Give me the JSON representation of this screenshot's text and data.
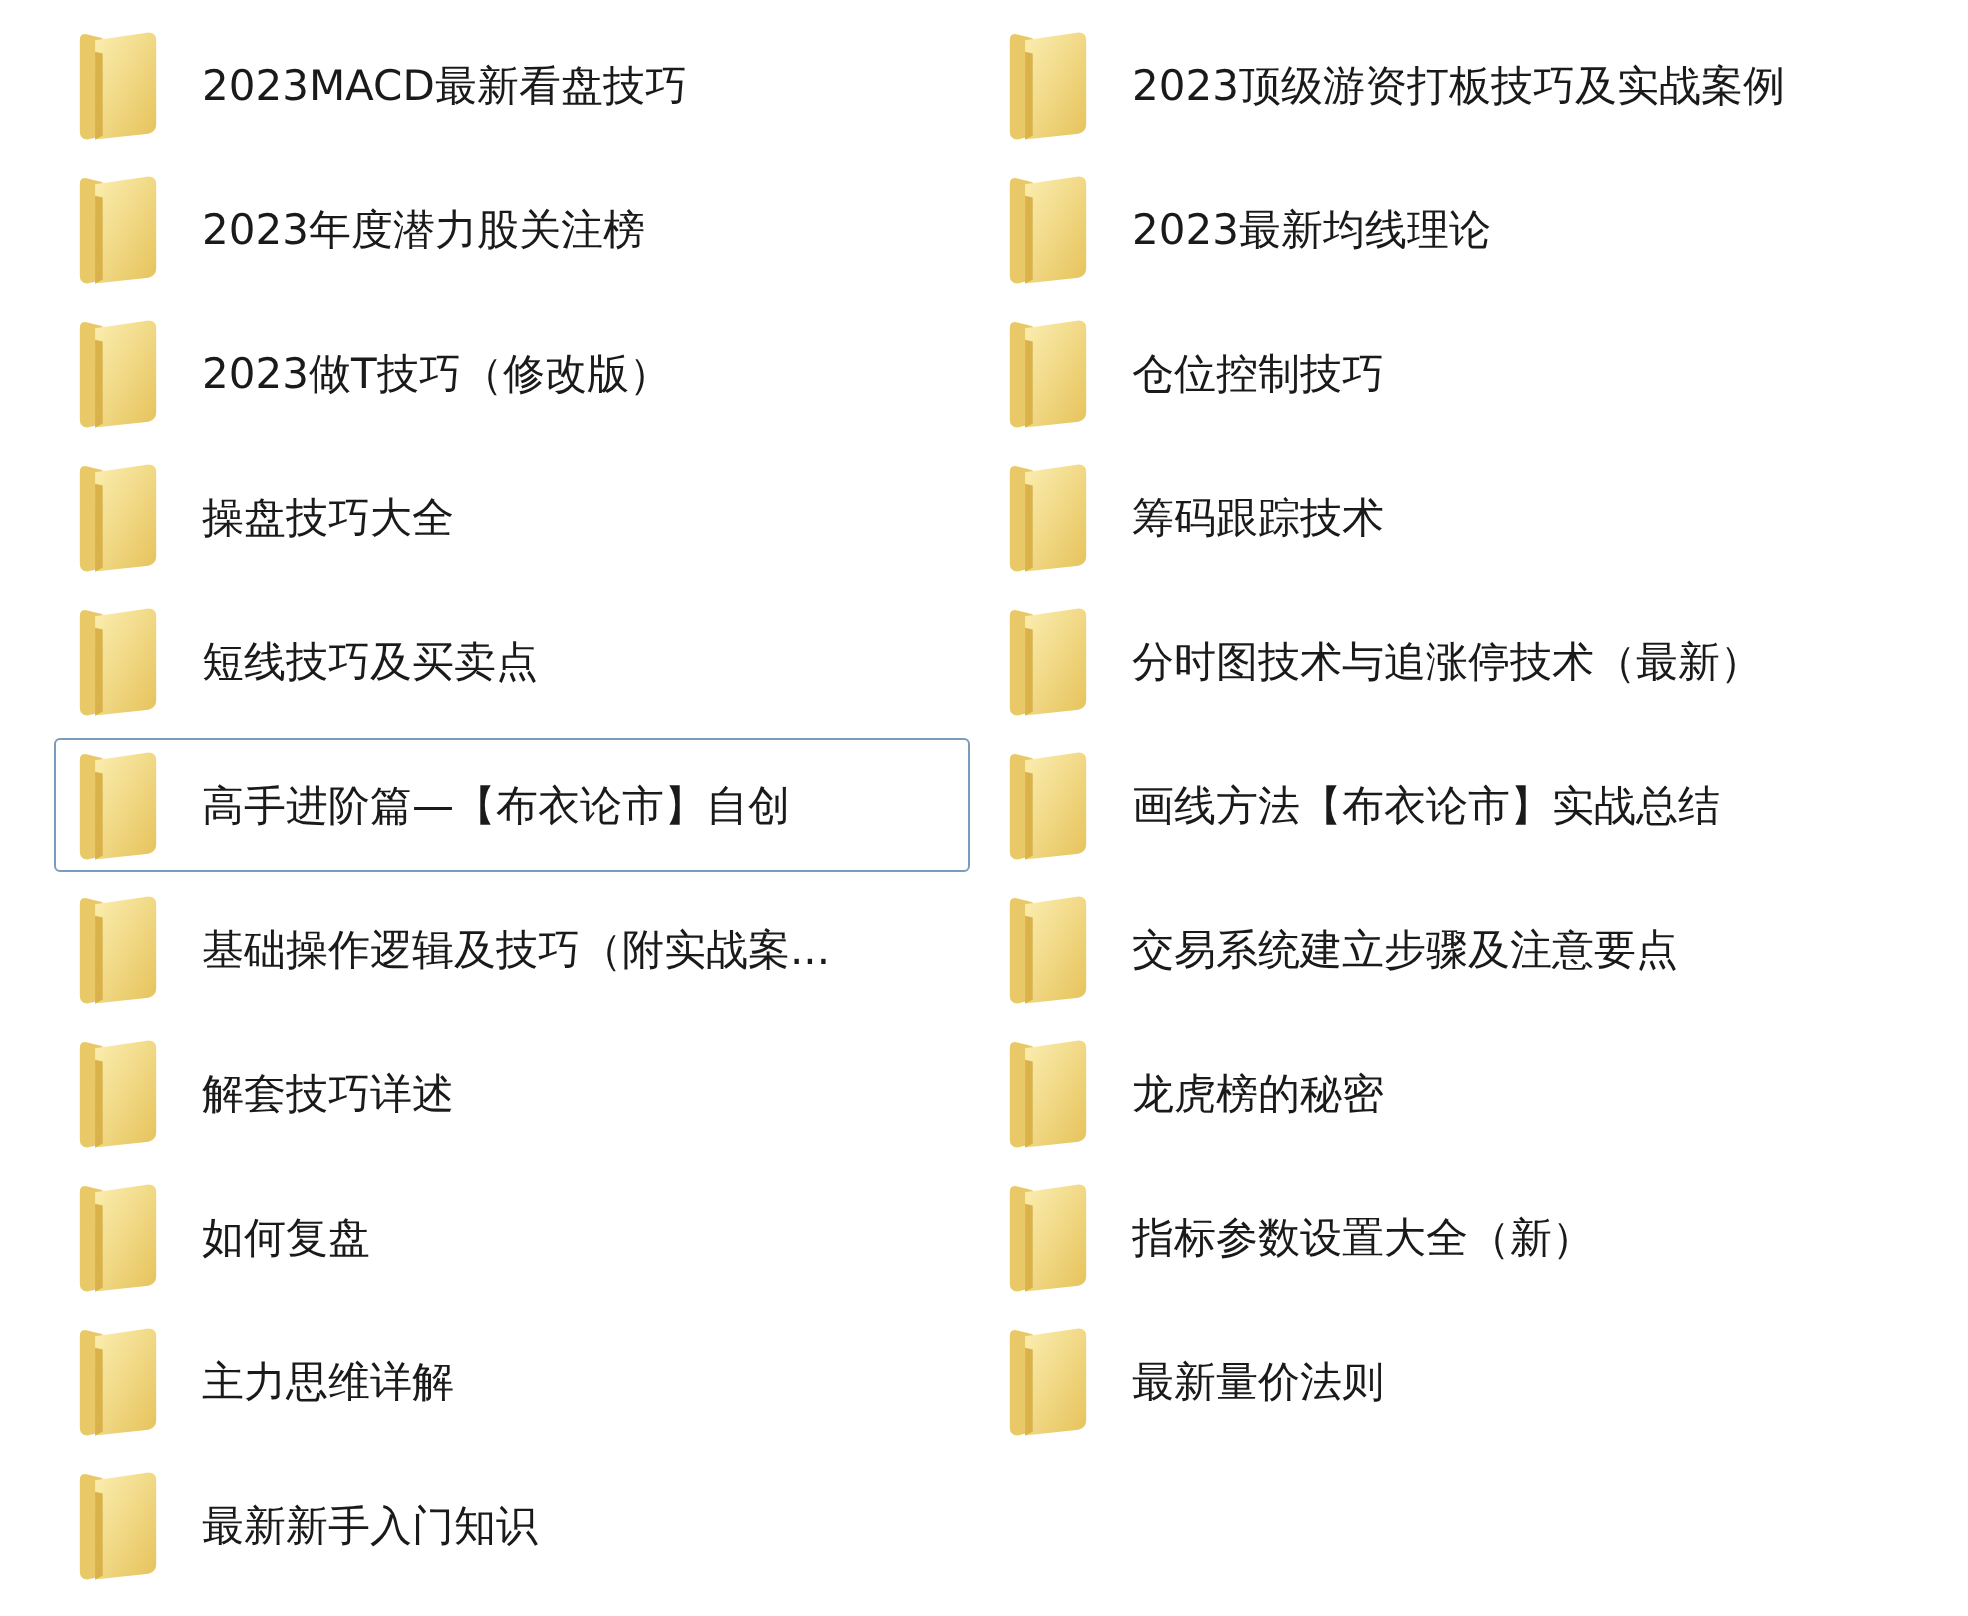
{
  "columns": [
    {
      "items": [
        {
          "name": "2023MACD最新看盘技巧",
          "selected": false
        },
        {
          "name": "2023年度潜力股关注榜",
          "selected": false
        },
        {
          "name": "2023做T技巧（修改版）",
          "selected": false
        },
        {
          "name": "操盘技巧大全",
          "selected": false
        },
        {
          "name": "短线技巧及买卖点",
          "selected": false
        },
        {
          "name": "高手进阶篇—【布衣论市】自创",
          "selected": true
        },
        {
          "name": "基础操作逻辑及技巧（附实战案...",
          "selected": false
        },
        {
          "name": "解套技巧详述",
          "selected": false
        },
        {
          "name": "如何复盘",
          "selected": false
        },
        {
          "name": "主力思维详解",
          "selected": false
        },
        {
          "name": "最新新手入门知识",
          "selected": false
        }
      ]
    },
    {
      "items": [
        {
          "name": "2023顶级游资打板技巧及实战案例",
          "selected": false
        },
        {
          "name": "2023最新均线理论",
          "selected": false
        },
        {
          "name": "仓位控制技巧",
          "selected": false
        },
        {
          "name": "筹码跟踪技术",
          "selected": false
        },
        {
          "name": "分时图技术与追涨停技术（最新）",
          "selected": false
        },
        {
          "name": "画线方法【布衣论市】实战总结",
          "selected": false
        },
        {
          "name": "交易系统建立步骤及注意要点",
          "selected": false
        },
        {
          "name": "龙虎榜的秘密",
          "selected": false
        },
        {
          "name": "指标参数设置大全（新）",
          "selected": false
        },
        {
          "name": "最新量价法则",
          "selected": false
        }
      ]
    }
  ]
}
